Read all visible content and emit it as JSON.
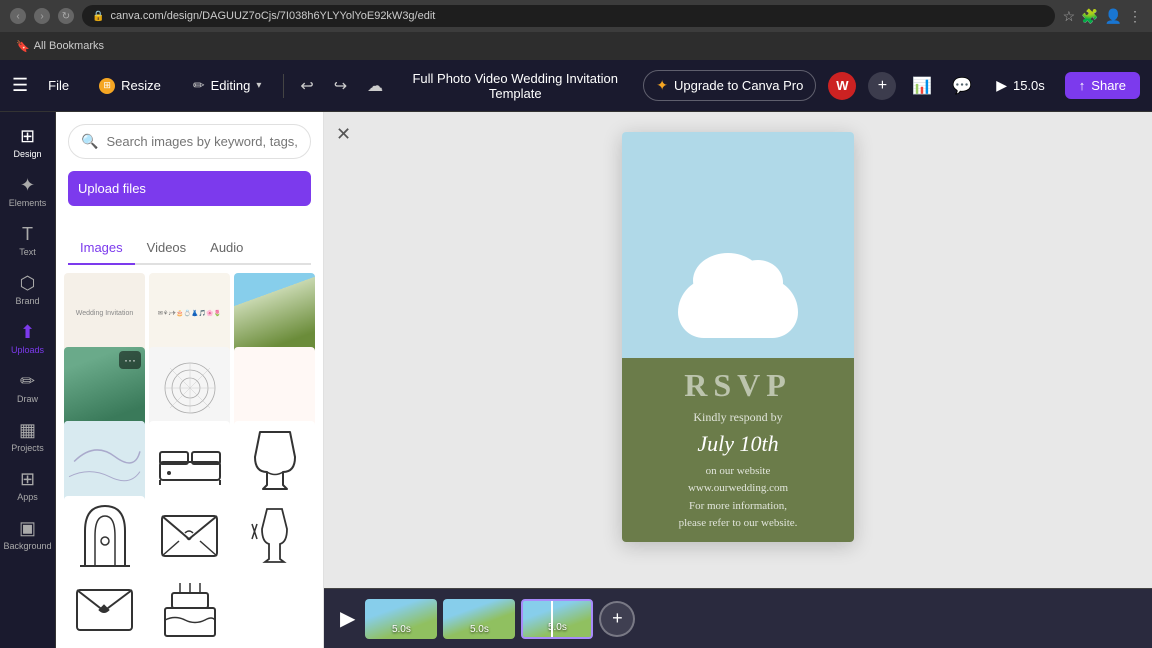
{
  "browser": {
    "url": "canva.com/design/DAGUUZ7oCjs/7I038h6YLYYolYoE92kW3g/edit",
    "bookmarks_label": "All Bookmarks",
    "back_disabled": true,
    "forward_disabled": true
  },
  "toolbar": {
    "menu_label": "☰",
    "file_label": "File",
    "resize_label": "Resize",
    "editing_label": "Editing",
    "undo_label": "↩",
    "redo_label": "↪",
    "cloud_label": "☁",
    "project_title": "Full Photo Video Wedding Invitation Template",
    "upgrade_label": "Upgrade to Canva Pro",
    "analytics_label": "📊",
    "comment_label": "💬",
    "timer_label": "15.0s",
    "share_label": "Share",
    "avatar_label": "W"
  },
  "sidebar": {
    "items": [
      {
        "id": "design",
        "label": "Design",
        "icon": "⊞"
      },
      {
        "id": "elements",
        "label": "Elements",
        "icon": "✦"
      },
      {
        "id": "text",
        "label": "Text",
        "icon": "T"
      },
      {
        "id": "brand",
        "label": "Brand",
        "icon": "⬡"
      },
      {
        "id": "uploads",
        "label": "Uploads",
        "icon": "⬆"
      },
      {
        "id": "draw",
        "label": "Draw",
        "icon": "✏"
      },
      {
        "id": "projects",
        "label": "Projects",
        "icon": "▦"
      },
      {
        "id": "apps",
        "label": "Apps",
        "icon": "⊞"
      },
      {
        "id": "background",
        "label": "Background",
        "icon": "▣"
      }
    ]
  },
  "media_panel": {
    "search_placeholder": "Search images by keyword, tags, color...",
    "upload_button": "Upload files",
    "tabs": [
      "Images",
      "Videos",
      "Audio"
    ],
    "active_tab": "Images"
  },
  "canvas": {
    "close_icon": "✕",
    "rsvp": {
      "title": "RSVP",
      "respond": "Kindly respond by",
      "date": "July 10th",
      "line1": "on our website",
      "line2": "www.ourwedding.com",
      "line3": "For more information,",
      "line4": "please refer to our website."
    }
  },
  "timeline": {
    "play_icon": "▶",
    "clips": [
      {
        "duration": "5.0s",
        "active": false
      },
      {
        "duration": "5.0s",
        "active": false
      },
      {
        "duration": "5.0s",
        "active": true
      }
    ],
    "add_icon": "+"
  }
}
